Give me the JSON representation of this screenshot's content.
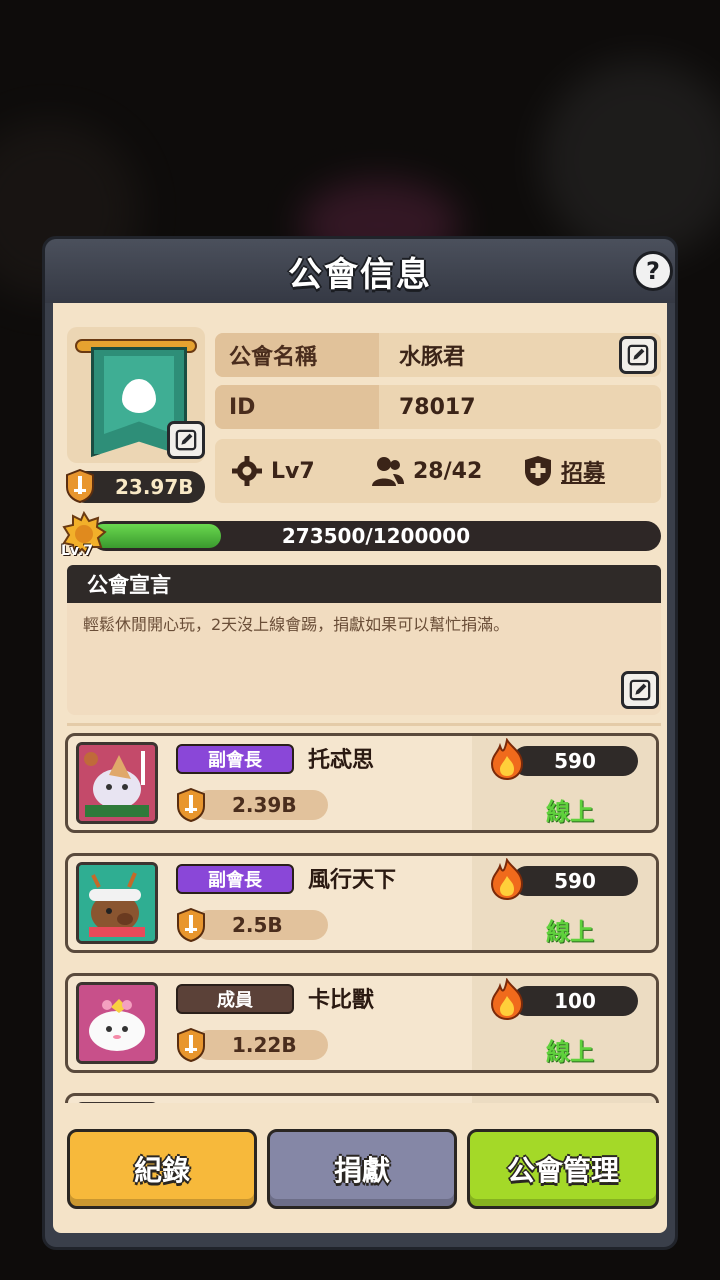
{
  "header": {
    "title": "公會信息",
    "help_label": "?"
  },
  "guild": {
    "power": "23.97B",
    "name_label": "公會名稱",
    "name": "水豚君",
    "id_label": "ID",
    "id": "78017",
    "level": "Lv7",
    "members": "28/42",
    "recruit_label": "招募",
    "exp_text": "273500/1200000",
    "exp_progress": 0.228,
    "level_badge": "Lv.7"
  },
  "declaration": {
    "title": "公會宣言",
    "text": "輕鬆休閒開心玩，2天沒上線會踢，捐獻如果可以幫忙捐滿。"
  },
  "members": [
    {
      "role": "副會長",
      "role_type": "vice",
      "name": "托忒思",
      "power": "2.39B",
      "activity": "590",
      "status": "線上",
      "avatar": "christmas-cake-avatar"
    },
    {
      "role": "副會長",
      "role_type": "vice",
      "name": "風行天下",
      "power": "2.5B",
      "activity": "590",
      "status": "線上",
      "avatar": "reindeer-capybara-avatar"
    },
    {
      "role": "成員",
      "role_type": "member",
      "name": "卡比獸",
      "power": "1.22B",
      "activity": "100",
      "status": "線上",
      "avatar": "white-cat-avatar"
    }
  ],
  "buttons": {
    "record": "紀錄",
    "donate": "捐獻",
    "manage": "公會管理"
  },
  "colors": {
    "panel_bg": "#f4e3c8",
    "vice_badge": "#8a47d8",
    "member_badge": "#5b4138",
    "online_green": "#5fd13c",
    "record_btn": "#f7b93b",
    "donate_btn": "#8587a6",
    "manage_btn": "#a4d928"
  }
}
